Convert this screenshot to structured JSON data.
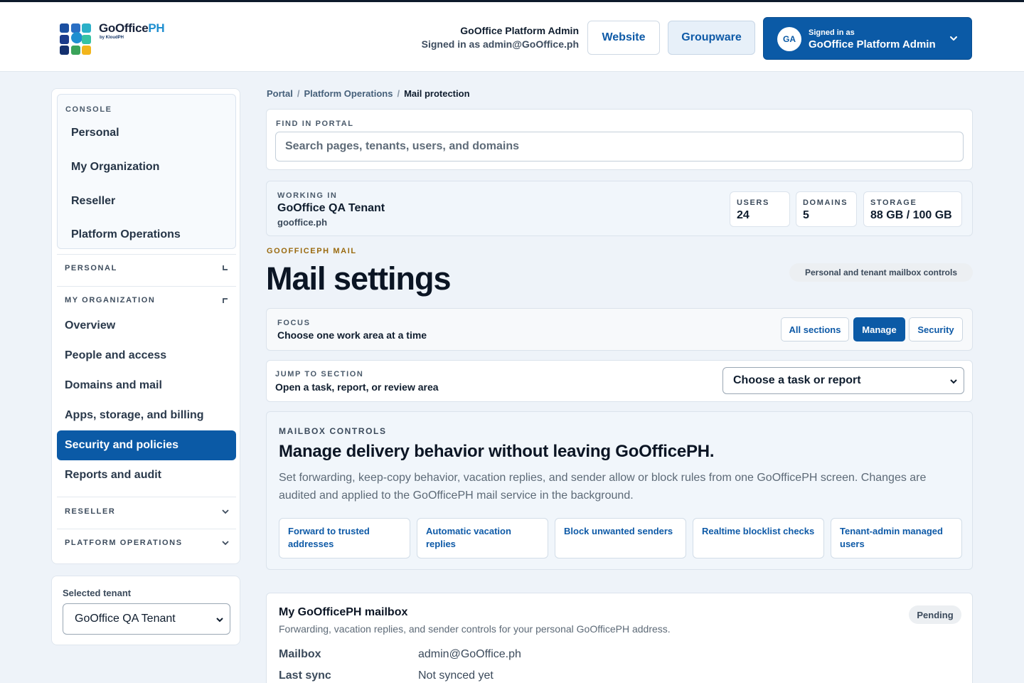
{
  "header": {
    "brand_main": "GoOffice",
    "brand_accent": "PH",
    "brand_sub": "by KloudPH",
    "user_name": "GoOffice Platform Admin",
    "user_email": "Signed in as admin@GoOffice.ph",
    "website_label": "Website",
    "groupware_label": "Groupware",
    "account": {
      "initials": "GA",
      "signed_in_label": "Signed in as",
      "name": "GoOffice Platform Admin"
    }
  },
  "sidebar": {
    "console_heading": "CONSOLE",
    "console_items": [
      "Personal",
      "My Organization",
      "Reseller",
      "Platform Operations"
    ],
    "groups": {
      "personal": "PERSONAL",
      "my_organization": "MY ORGANIZATION",
      "reseller": "RESELLER",
      "platform_operations": "PLATFORM OPERATIONS"
    },
    "org_items": [
      "Overview",
      "People and access",
      "Domains and mail",
      "Apps, storage, and billing",
      "Security and policies",
      "Reports and audit"
    ],
    "active_item": "Security and policies"
  },
  "tenant_card": {
    "label": "Selected tenant",
    "selected": "GoOffice QA Tenant"
  },
  "breadcrumb": [
    "Portal",
    "Platform Operations",
    "Mail protection"
  ],
  "find": {
    "heading": "FIND IN PORTAL",
    "placeholder": "Search pages, tenants, users, and domains"
  },
  "working": {
    "heading": "WORKING IN",
    "tenant": "GoOffice QA Tenant",
    "domain": "gooffice.ph",
    "stats": [
      {
        "label": "USERS",
        "value": "24"
      },
      {
        "label": "DOMAINS",
        "value": "5"
      },
      {
        "label": "STORAGE",
        "value": "88 GB / 100 GB"
      }
    ]
  },
  "page": {
    "kicker": "GOOFFICEPH MAIL",
    "title": "Mail settings",
    "pill": "Personal and tenant mailbox controls"
  },
  "focus": {
    "heading": "FOCUS",
    "text": "Choose one work area at a time",
    "options": [
      "All sections",
      "Manage",
      "Security"
    ],
    "selected": "Manage"
  },
  "jump": {
    "heading": "JUMP TO SECTION",
    "text": "Open a task, report, or review area",
    "select_value": "Choose a task or report"
  },
  "mailbox_controls": {
    "heading": "MAILBOX CONTROLS",
    "title": "Manage delivery behavior without leaving GoOfficePH.",
    "description": "Set forwarding, keep-copy behavior, vacation replies, and sender allow or block rules from one GoOfficePH screen. Changes are audited and applied to the GoOfficePH mail service in the background.",
    "features": [
      "Forward to trusted addresses",
      "Automatic vacation replies",
      "Block unwanted senders",
      "Realtime blocklist checks",
      "Tenant-admin managed users"
    ]
  },
  "my_mailbox": {
    "title": "My GoOfficePH mailbox",
    "subtitle": "Forwarding, vacation replies, and sender controls for your personal GoOfficePH address.",
    "status": "Pending",
    "rows": [
      {
        "key": "Mailbox",
        "value": "admin@GoOffice.ph"
      },
      {
        "key": "Last sync",
        "value": "Not synced yet"
      }
    ]
  },
  "colors": {
    "primary": "#0b5aa6",
    "accent_gold": "#9a6a0f",
    "page_bg": "#eef3f9"
  }
}
